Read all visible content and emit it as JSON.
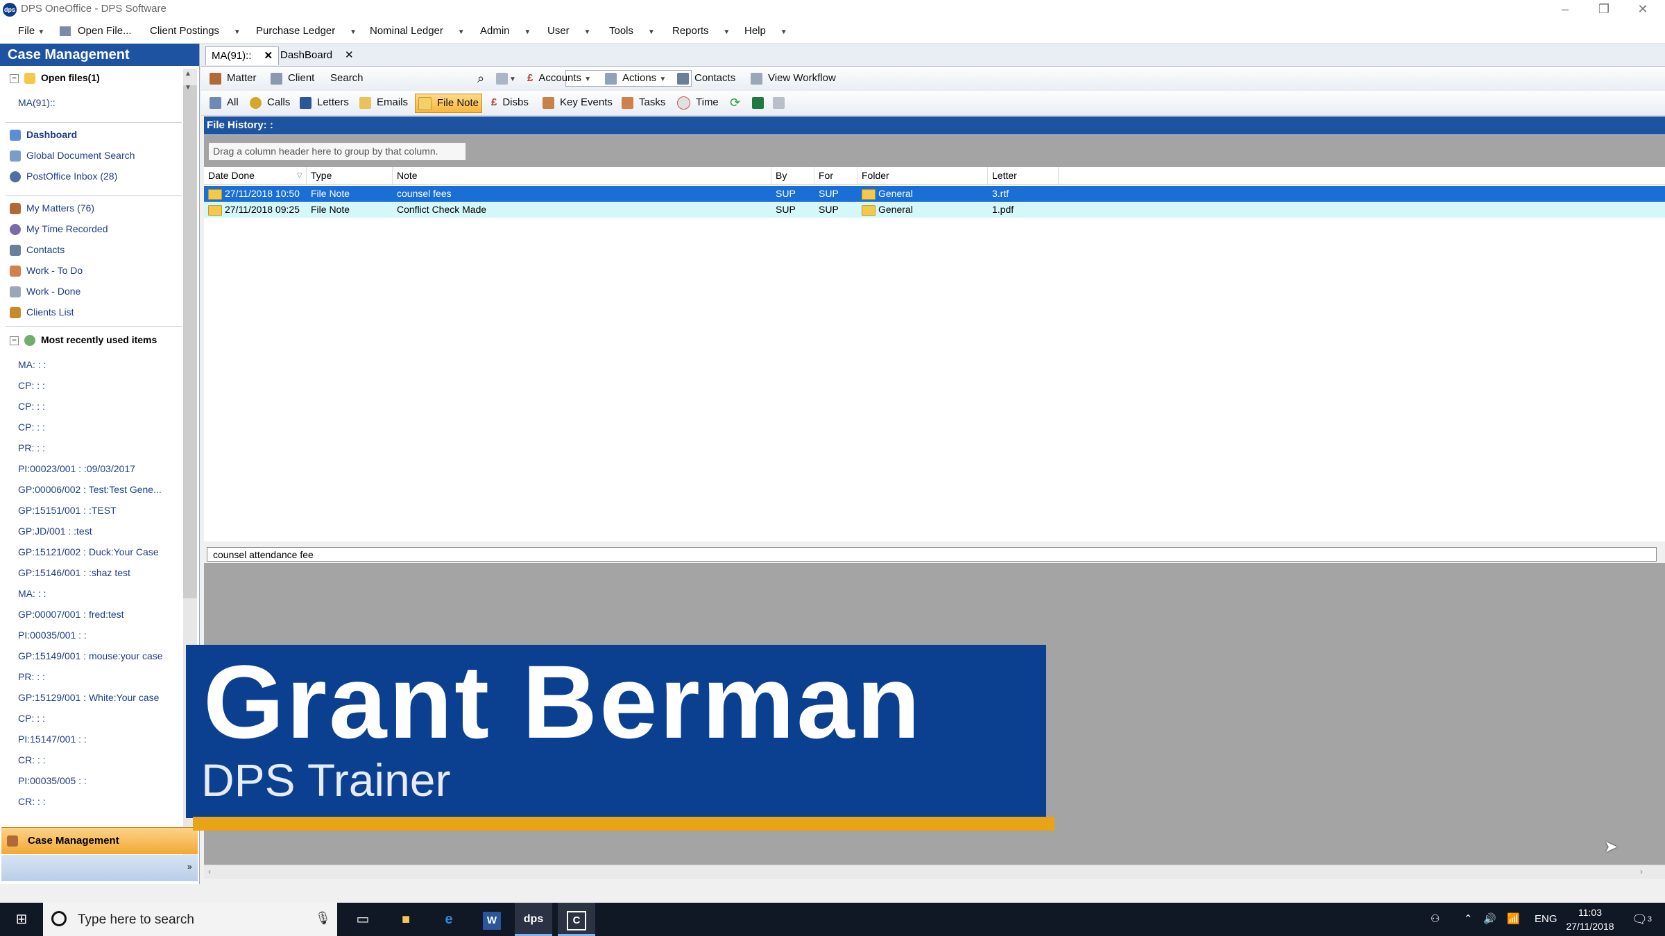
{
  "window": {
    "title": "DPS OneOffice - DPS Software",
    "logo_text": "dps"
  },
  "menu": {
    "file": "File",
    "open_file": "Open File...",
    "client_postings": "Client Postings",
    "purchase_ledger": "Purchase Ledger",
    "nominal_ledger": "Nominal Ledger",
    "admin": "Admin",
    "user": "User",
    "tools": "Tools",
    "reports": "Reports",
    "help": "Help"
  },
  "left_pane": {
    "header": "Case Management",
    "open_files": {
      "label": "Open files(1)",
      "items": [
        "MA(91)::"
      ]
    },
    "nav": [
      {
        "label": "Dashboard",
        "icon": "dashboard-icon",
        "color": "#5a8fd6"
      },
      {
        "label": "Global Document Search",
        "icon": "document-search-icon",
        "color": "#7b9cc9"
      },
      {
        "label": "PostOffice Inbox (28)",
        "icon": "inbox-icon",
        "color": "#4f6f9e"
      }
    ],
    "nav2": [
      {
        "label": "My Matters (76)",
        "icon": "matters-icon",
        "color": "#b06a3a"
      },
      {
        "label": "My Time Recorded",
        "icon": "time-icon",
        "color": "#7a6aa8"
      },
      {
        "label": "Contacts",
        "icon": "contacts-icon",
        "color": "#6c7f9a"
      },
      {
        "label": "Work - To Do",
        "icon": "todo-icon",
        "color": "#d0804a"
      },
      {
        "label": "Work - Done",
        "icon": "done-icon",
        "color": "#9aa7b7"
      },
      {
        "label": "Clients List",
        "icon": "clients-icon",
        "color": "#c78a2a"
      }
    ],
    "recent": {
      "label": "Most recently used items",
      "items": [
        "MA: : :",
        "CP: : :",
        "CP: : :",
        "CP: : :",
        "PR: : :",
        "PI:00023/001 : :09/03/2017",
        "GP:00006/002 : Test:Test Gene...",
        "GP:15151/001 : :TEST",
        "GP:JD/001 : :test",
        "GP:15121/002 : Duck:Your Case",
        "GP:15146/001 : :shaz test",
        "MA: : :",
        "GP:00007/001 : fred:test",
        "PI:00035/001 : :",
        "GP:15149/001 : mouse:your case",
        "PR: : :",
        "GP:15129/001 : White:Your case",
        "CP: : :",
        "PI:15147/001 : :",
        "CR: : :",
        "PI:00035/005 : :",
        "CR: : :"
      ]
    },
    "bottom_section": "Case Management"
  },
  "tabs": [
    {
      "label": "MA(91)::",
      "active": true
    },
    {
      "label": "DashBoard",
      "active": false
    }
  ],
  "toolbar1": {
    "matter": "Matter",
    "client": "Client",
    "search_label": "Search",
    "search_value": "",
    "accounts": "Accounts",
    "actions": "Actions",
    "contacts": "Contacts",
    "view_workflow": "View Workflow"
  },
  "toolbar2": {
    "all": "All",
    "calls": "Calls",
    "letters": "Letters",
    "emails": "Emails",
    "file_note": "File Note",
    "disbs": "Disbs",
    "key_events": "Key Events",
    "tasks": "Tasks",
    "time": "Time"
  },
  "file_history": {
    "header": "File History: :",
    "group_hint": "Drag a column header here to group by that column.",
    "columns": [
      "Date Done",
      "Type",
      "Note",
      "By",
      "For",
      "Folder",
      "Letter"
    ],
    "rows": [
      {
        "date": "27/11/2018 10:50",
        "type": "File Note",
        "note": "counsel fees",
        "by": "SUP",
        "for": "SUP",
        "folder": "General",
        "letter": "3.rtf",
        "selected": true
      },
      {
        "date": "27/11/2018 09:25",
        "type": "File Note",
        "note": "Conflict Check Made",
        "by": "SUP",
        "for": "SUP",
        "folder": "General",
        "letter": "1.pdf",
        "selected": false
      }
    ],
    "note_preview": "counsel attendance fee"
  },
  "overlay": {
    "name": "Grant Berman",
    "role": "DPS Trainer"
  },
  "taskbar": {
    "search_placeholder": "Type here to search",
    "lang": "ENG",
    "time": "11:03",
    "date": "27/11/2018",
    "notifications": "3"
  }
}
